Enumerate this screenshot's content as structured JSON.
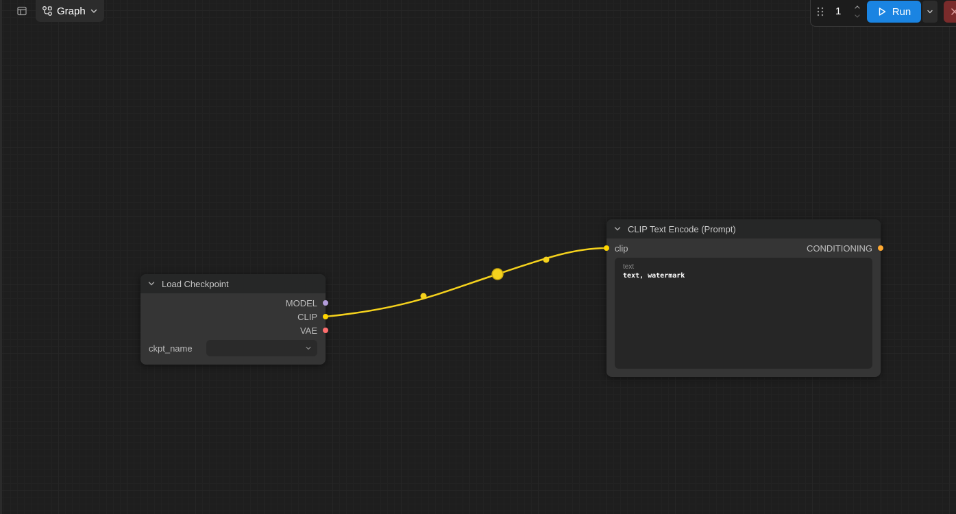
{
  "toolbar": {
    "graph_label": "Graph"
  },
  "run_panel": {
    "batch_count": "1",
    "run_label": "Run"
  },
  "nodes": {
    "load_checkpoint": {
      "title": "Load Checkpoint",
      "outputs": [
        "MODEL",
        "CLIP",
        "VAE"
      ],
      "widget_label": "ckpt_name",
      "widget_value": ""
    },
    "clip_text_encode": {
      "title": "CLIP Text Encode (Prompt)",
      "input": "clip",
      "output": "CONDITIONING",
      "text_label": "text",
      "text_value": "text, watermark"
    }
  },
  "colors": {
    "canvas": "#1e1e1e",
    "node_body": "#353535",
    "node_header": "#262727",
    "link_clip": "#f5d21d",
    "slot_model": "#b39ddb",
    "slot_clip": "#ffd500",
    "slot_vae": "#ff6e6e",
    "slot_conditioning": "#ffa931",
    "run_button": "#1a84e2",
    "stop_button": "#7a2b2b"
  },
  "icons": {
    "panel": "layout-sidebar-icon",
    "graph": "workflow-icon",
    "run": "play-icon",
    "stop": "close-icon",
    "drag": "grip-vertical-icon"
  }
}
